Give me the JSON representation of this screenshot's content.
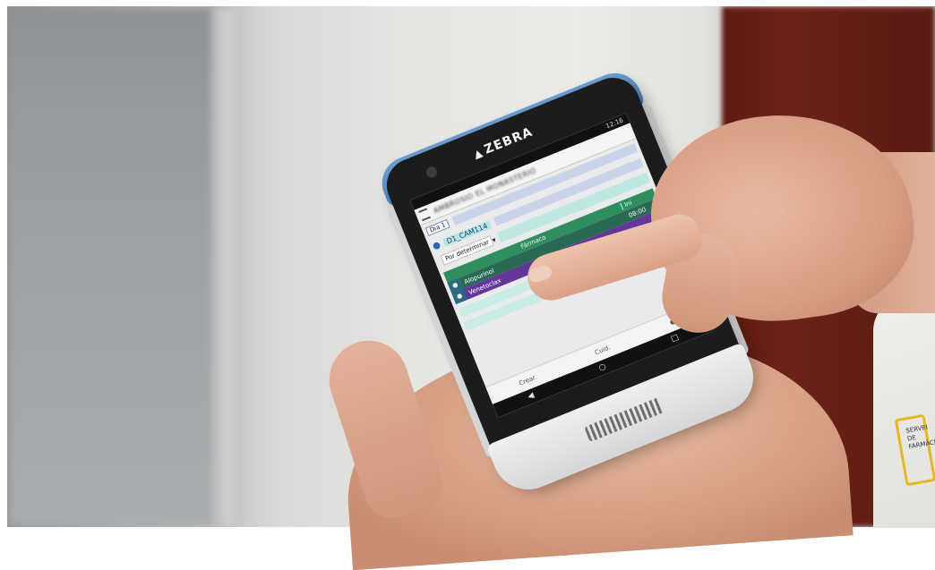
{
  "device": {
    "brand_label": "ZEBRA",
    "brand_icon": "zebra-logo-icon"
  },
  "screen": {
    "status_time": "12:16",
    "header_title": "AMBROSIO EL MONASTERIO",
    "day_tag": "Dia 1",
    "room_label": "D1_CAM114",
    "dropdown_value": "Por determinar",
    "table": {
      "col_drug": "Fármaco",
      "col_time": "Ini",
      "rows": [
        {
          "name": "Alopurinol",
          "time": "08:00",
          "color": "#2a6a55"
        },
        {
          "name": "Venetoclax",
          "time": "",
          "color": "#63379a"
        }
      ]
    },
    "bottom_labels": [
      "Crear",
      "Cuid."
    ],
    "nav_icons": [
      "back-icon",
      "home-icon",
      "recents-icon"
    ]
  },
  "coat": {
    "print_text": "SERVEI DE FARMÀCIA"
  }
}
